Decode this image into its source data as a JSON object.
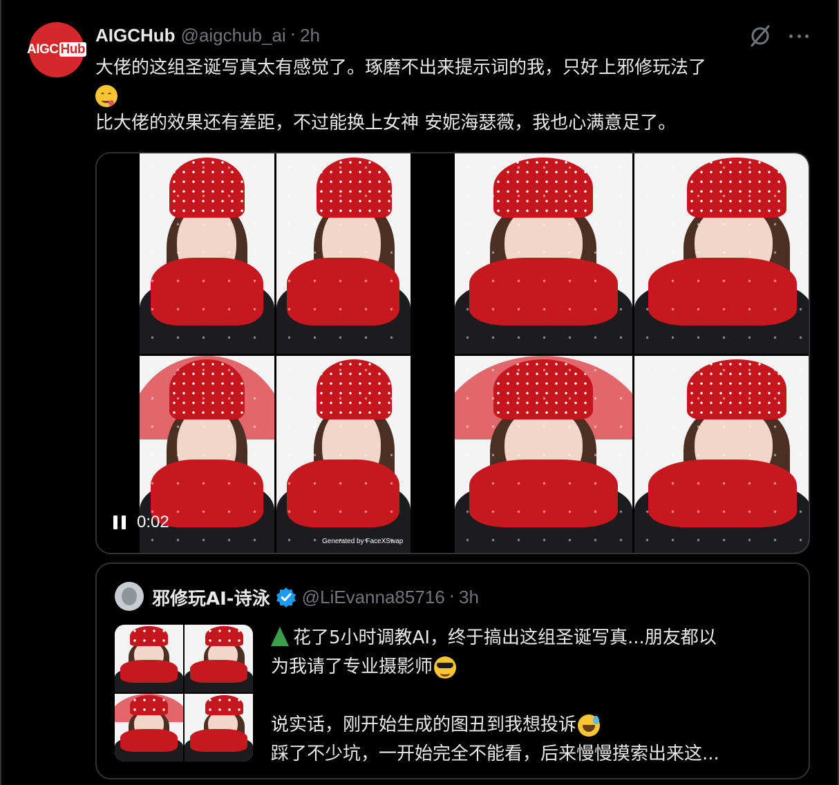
{
  "post": {
    "avatar_logo": {
      "part1": "AIGC",
      "part2": "Hub"
    },
    "display_name": "AIGCHub",
    "handle": "@aigchub_ai",
    "separator": "·",
    "time": "2h",
    "text": {
      "line1": "大佬的这组圣诞写真太有感觉了。琢磨不出来提示词的我，只好上邪修玩法了",
      "line3": "比大佬的效果还有差距，不过能换上女神 安妮海瑟薇，我也心满意足了。"
    },
    "icons": {
      "grok": "grok-slash-icon",
      "more": "more-options-icon",
      "emoji": "face-savoring-food-emoji"
    },
    "video": {
      "time": "0:02",
      "watermark": "Generated by FaceXSwap"
    }
  },
  "quoted": {
    "display_name": "邪修玩AI-诗泳",
    "handle": "@LiEvanna85716",
    "separator": "·",
    "time": "3h",
    "verified_color": "#1d9bf0",
    "text": {
      "line1": "花了5小时调教AI，终于搞出这组圣诞写真...朋友都以",
      "line2": "为我请了专业摄影师",
      "line4": "说实话，刚开始生成的图丑到我想投诉",
      "line5": "踩了不少坑，一开始完全不能看，后来慢慢摸索出来这..."
    },
    "icons": {
      "tree": "christmas-tree-emoji",
      "cool": "sunglasses-face-emoji",
      "sweat": "grinning-sweat-emoji"
    }
  },
  "colors": {
    "background": "#000000",
    "text": "#e7e9ea",
    "secondary": "#71767b",
    "border": "#2f3336",
    "brand_red": "#d6282b"
  }
}
